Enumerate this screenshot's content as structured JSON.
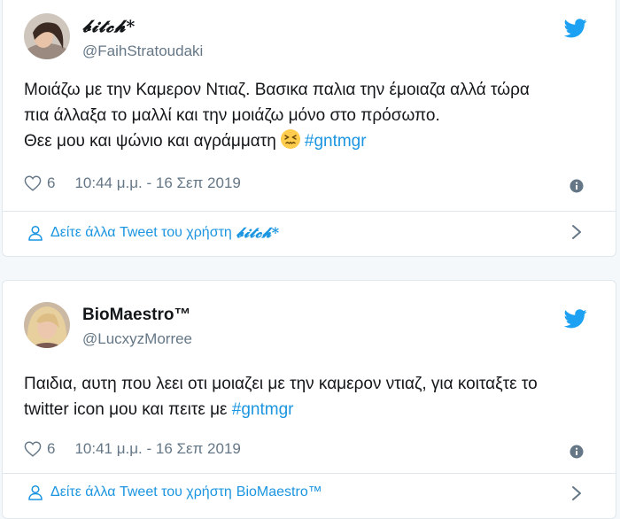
{
  "colors": {
    "accent": "#1b95e0",
    "muted": "#657786",
    "text": "#14171a",
    "border": "#e1e8ed",
    "background": "#f5f8fa"
  },
  "tweets": [
    {
      "display_name": "𝓫𝓲𝓽𝓬𝓱*",
      "handle": "@FaihStratoudaki",
      "text_lines": [
        "Μοιάζω με την Καμερον Ντιαζ. Βασικα παλια την έμοιαζα αλλά τώρα",
        "πια άλλαξα το μαλλί και την μοιάζω μόνο στο πρόσωπο.",
        "Θεε μου και ψώνιο και αγράμματη"
      ],
      "emoji": "confounded-face-icon",
      "hashtag": "#gntmgr",
      "likes": "6",
      "timestamp": "10:44 μ.μ. - 16 Σεπ 2019",
      "more_link_prefix": "Δείτε άλλα Tweet του χρήστη",
      "more_link_name": "𝓫𝓲𝓽𝓬𝓱*",
      "icons": [
        "twitter-bird-icon",
        "heart-icon",
        "info-icon",
        "person-icon",
        "chevron-right-icon"
      ]
    },
    {
      "display_name": "BioMaestro™",
      "handle": "@LucxyzMorree",
      "text_lines": [
        "Παιδια, αυτη που λεει οτι μοιαζει με την καμερον ντιαζ, για κοιταξτε το",
        "twitter icon μου και πειτε με"
      ],
      "hashtag": "#gntmgr",
      "likes": "6",
      "timestamp": "10:41 μ.μ. - 16 Σεπ 2019",
      "more_link_prefix": "Δείτε άλλα Tweet του χρήστη",
      "more_link_name": "BioMaestro™",
      "icons": [
        "twitter-bird-icon",
        "heart-icon",
        "info-icon",
        "person-icon",
        "chevron-right-icon"
      ]
    }
  ]
}
